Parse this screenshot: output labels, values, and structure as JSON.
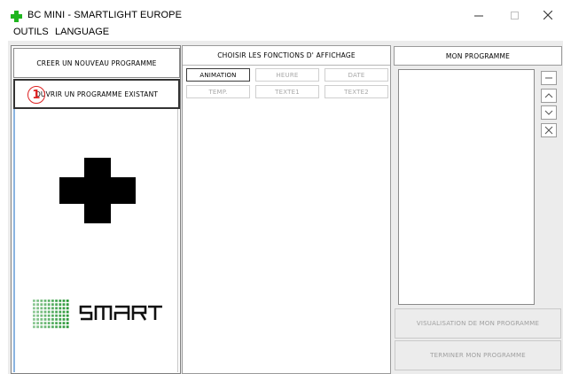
{
  "window": {
    "title": "BC MINI  - SMARTLIGHT EUROPE",
    "icon": "green-cross-icon",
    "minimize_icon": "minimize-icon",
    "maximize_icon": "maximize-icon",
    "close_icon": "close-icon"
  },
  "menu": {
    "items": [
      {
        "label": "OUTILS"
      },
      {
        "label": "LANGUAGE"
      }
    ]
  },
  "left_panel": {
    "new_program_label": "CREER UN NOUVEAU PROGRAMME",
    "open_program_label": "OUVRIR UN PROGRAMME EXISTANT",
    "annotation_marker": "1",
    "logo_icon": "black-cross-logo",
    "brand_logo": "smart-logo"
  },
  "middle_panel": {
    "header": "CHOISIR LES FONCTIONS D' AFFICHAGE",
    "function_buttons": [
      {
        "label": "ANIMATION",
        "enabled": true
      },
      {
        "label": "HEURE",
        "enabled": false
      },
      {
        "label": "DATE",
        "enabled": false
      },
      {
        "label": "TEMP.",
        "enabled": false
      },
      {
        "label": "TEXTE1",
        "enabled": false
      },
      {
        "label": "TEXTE2",
        "enabled": false
      }
    ]
  },
  "right_panel": {
    "header": "MON PROGRAMME",
    "side_buttons": [
      {
        "icon": "minus-icon"
      },
      {
        "icon": "chevron-up-icon"
      },
      {
        "icon": "chevron-down-icon"
      },
      {
        "icon": "delete-x-icon"
      }
    ],
    "preview_label": "VISUALISATION DE MON PROGRAMME",
    "finish_label": "TERMINER MON PROGRAMME"
  },
  "colors": {
    "accent_green": "#1fb51f",
    "annotation_red": "#d22222",
    "logo_green": "#2e9a3c"
  }
}
